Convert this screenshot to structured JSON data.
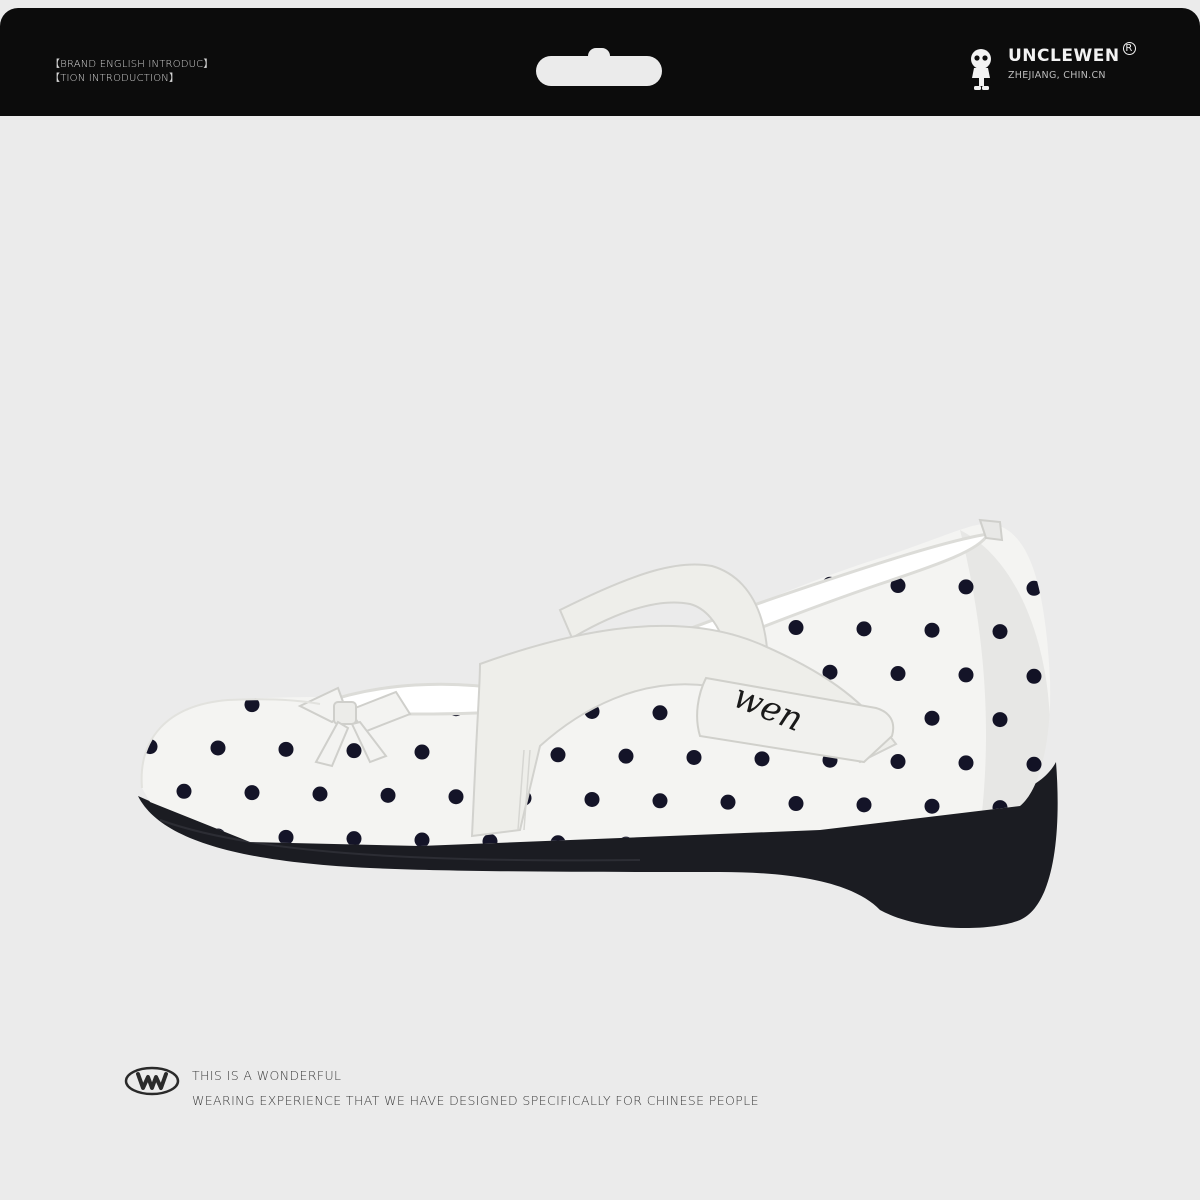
{
  "header": {
    "intro_line_1": "【BRAND ENGLISH INTRODUC】",
    "intro_line_2": "【TION INTRODUCTION】",
    "brand_name": "UNCLEWEN",
    "brand_registered": "R",
    "brand_location": "ZHEJIANG, CHIN.CN"
  },
  "product": {
    "strap_logo_text": "wen",
    "colors": {
      "upper": "#f4f4f2",
      "dots": "#141428",
      "sole": "#1b1c22",
      "strap": "#eeeeea"
    }
  },
  "footer": {
    "line_1": "THIS IS A WONDERFUL",
    "line_2": "WEARING EXPERIENCE THAT WE HAVE DESIGNED SPECIFICALLY FOR CHINESE PEOPLE",
    "logo_icon": "w-circle-logo"
  },
  "colors": {
    "background": "#ebebeb",
    "header_bar": "#0c0c0c"
  }
}
